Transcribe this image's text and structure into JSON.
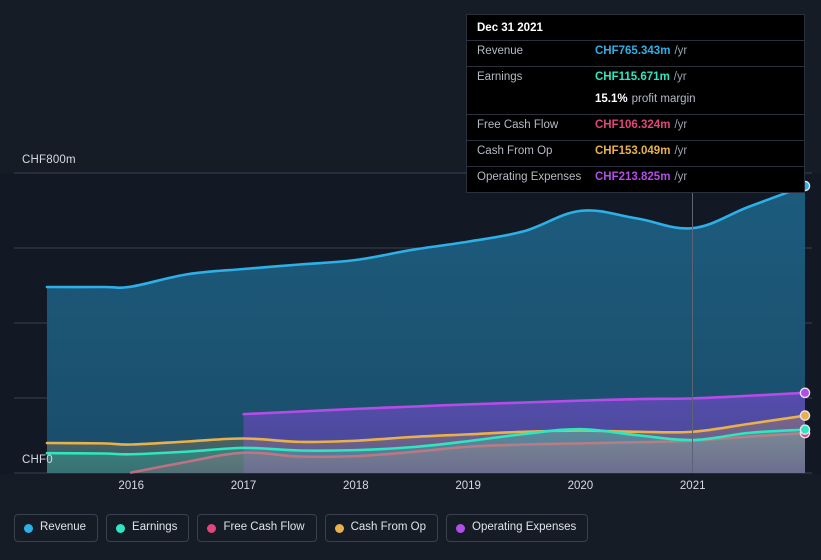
{
  "chart_data": {
    "type": "area",
    "title": "",
    "currency": "CHF",
    "xlabel": "",
    "ylabel": "",
    "axis": {
      "y_top_label": "CHF800m",
      "y_bottom_label": "CHF0",
      "ylim": [
        0,
        800
      ],
      "gridlines": [
        0,
        200,
        400,
        600,
        800
      ],
      "grid": true,
      "x_ticks": [
        "2016",
        "2017",
        "2018",
        "2019",
        "2020",
        "2021"
      ],
      "xlim": [
        "2015.25",
        "2022.0"
      ]
    },
    "legend_position": "bottom-left",
    "series": [
      {
        "name": "Revenue",
        "color": "#2dafe8",
        "x": [
          2015.25,
          2015.75,
          2016.0,
          2016.5,
          2017.0,
          2017.5,
          2018.0,
          2018.5,
          2019.0,
          2019.5,
          2020.0,
          2020.5,
          2021.0,
          2021.5,
          2022.0
        ],
        "values": [
          496,
          496,
          497,
          530,
          544,
          556,
          568,
          595,
          617,
          645,
          699,
          679,
          653,
          710,
          765.343
        ]
      },
      {
        "name": "Earnings",
        "color": "#2ee6c0",
        "x": [
          2015.25,
          2015.75,
          2016.0,
          2016.5,
          2017.0,
          2017.5,
          2018.0,
          2018.5,
          2019.0,
          2019.5,
          2020.0,
          2020.5,
          2021.0,
          2021.5,
          2022.0
        ],
        "values": [
          53,
          52,
          50,
          57,
          67,
          60,
          61,
          69,
          85,
          104,
          117,
          101,
          88,
          107,
          115.671
        ]
      },
      {
        "name": "Free Cash Flow",
        "color": "#e0457b",
        "x": [
          2016.0,
          2016.5,
          2017.0,
          2017.5,
          2018.0,
          2018.5,
          2019.0,
          2019.5,
          2020.0,
          2020.5,
          2021.0,
          2021.5,
          2022.0
        ],
        "values": [
          1,
          30,
          54,
          44,
          45,
          56,
          70,
          76,
          79,
          82,
          86,
          97,
          106.324
        ]
      },
      {
        "name": "Cash From Op",
        "color": "#e8b14c",
        "x": [
          2015.25,
          2015.75,
          2016.0,
          2016.5,
          2017.0,
          2017.5,
          2018.0,
          2018.5,
          2019.0,
          2019.5,
          2020.0,
          2020.5,
          2021.0,
          2021.5,
          2022.0
        ],
        "values": [
          80,
          79,
          76,
          84,
          92,
          83,
          86,
          96,
          103,
          110,
          113,
          110,
          110,
          131,
          153.049
        ]
      },
      {
        "name": "Operating Expenses",
        "color": "#b44ce8",
        "x": [
          2017.0,
          2017.5,
          2018.0,
          2018.5,
          2019.0,
          2019.5,
          2020.0,
          2020.5,
          2021.0,
          2021.5,
          2022.0
        ],
        "values": [
          157,
          164,
          171,
          177,
          183,
          188,
          193,
          197,
          199,
          206,
          213.825
        ]
      }
    ]
  },
  "tooltip": {
    "title": "Dec 31 2021",
    "unit": "/yr",
    "rows": [
      {
        "label": "Revenue",
        "value": "CHF765.343m",
        "color": "#2dafe8"
      },
      {
        "label": "Earnings",
        "value": "CHF115.671m",
        "color": "#2ee6c0"
      },
      {
        "label": "Free Cash Flow",
        "value": "CHF106.324m",
        "color": "#e0457b"
      },
      {
        "label": "Cash From Op",
        "value": "CHF153.049m",
        "color": "#e8b14c"
      },
      {
        "label": "Operating Expenses",
        "value": "CHF213.825m",
        "color": "#b44ce8"
      }
    ],
    "margin_value": "15.1%",
    "margin_text": "profit margin"
  },
  "legend": {
    "items": [
      {
        "label": "Revenue",
        "color": "#2dafe8"
      },
      {
        "label": "Earnings",
        "color": "#2ee6c0"
      },
      {
        "label": "Free Cash Flow",
        "color": "#e0457b"
      },
      {
        "label": "Cash From Op",
        "color": "#e8b14c"
      },
      {
        "label": "Operating Expenses",
        "color": "#b44ce8"
      }
    ]
  },
  "axis_labels": {
    "y_top": "CHF800m",
    "y_bottom": "CHF0",
    "x": [
      "2016",
      "2017",
      "2018",
      "2019",
      "2020",
      "2021"
    ]
  }
}
